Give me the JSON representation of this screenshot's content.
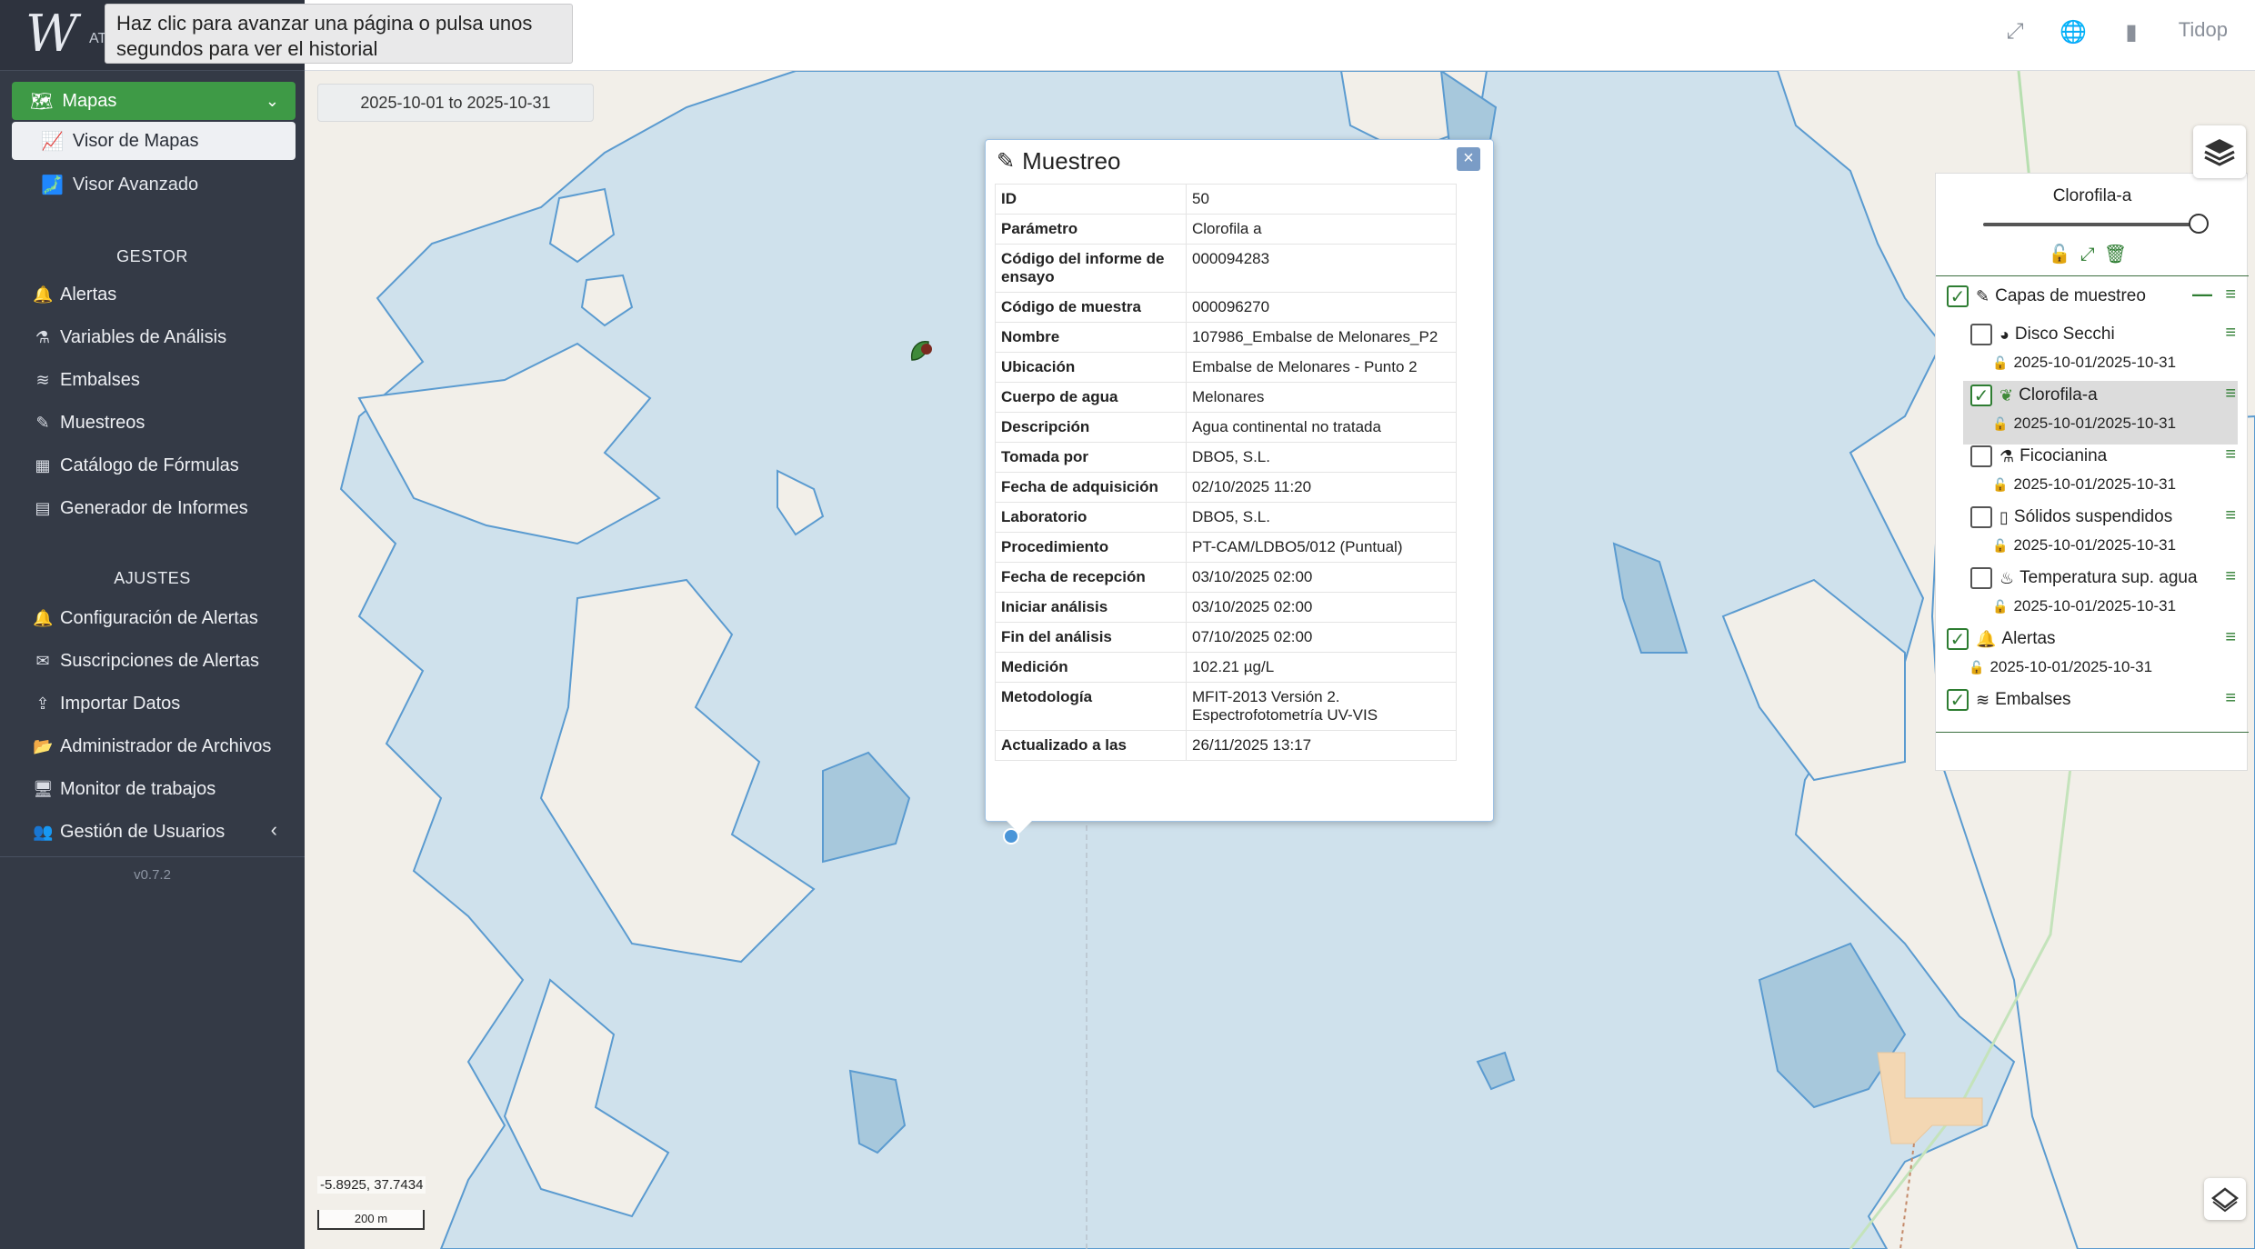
{
  "tooltip": {
    "text": "Haz clic para avanzar una página o pulsa unos segundos para ver el historial"
  },
  "logo": {
    "sub": "AT"
  },
  "sidebar": {
    "mapas": {
      "label": "Mapas"
    },
    "visor_mapas": "Visor de Mapas",
    "visor_avanzado": "Visor Avanzado",
    "gestor_head": "GESTOR",
    "gestor_items": [
      "Alertas",
      "Variables de Análisis",
      "Embalses",
      "Muestreos",
      "Catálogo de Fórmulas",
      "Generador de Informes"
    ],
    "ajustes_head": "AJUSTES",
    "ajustes_items": [
      "Configuración de Alertas",
      "Suscripciones de Alertas",
      "Importar Datos",
      "Administrador de Archivos",
      "Monitor de trabajos",
      "Gestión de Usuarios"
    ],
    "version": "v0.7.2"
  },
  "topbar": {
    "user": "Tidop"
  },
  "map": {
    "date_range": "2025-10-01 to 2025-10-31",
    "coords": "-5.8925, 37.7434",
    "scale": "200 m"
  },
  "popup": {
    "title": "Muestreo",
    "close": "×",
    "rows": [
      {
        "k": "ID",
        "v": "50"
      },
      {
        "k": "Parámetro",
        "v": "Clorofila a"
      },
      {
        "k": "Código del informe de ensayo",
        "v": "000094283"
      },
      {
        "k": "Código de muestra",
        "v": "000096270"
      },
      {
        "k": "Nombre",
        "v": "107986_Embalse de Melonares_P2"
      },
      {
        "k": "Ubicación",
        "v": "Embalse de Melonares - Punto 2"
      },
      {
        "k": "Cuerpo de agua",
        "v": "Melonares"
      },
      {
        "k": "Descripción",
        "v": "Agua continental no tratada"
      },
      {
        "k": "Tomada por",
        "v": "DBO5, S.L."
      },
      {
        "k": "Fecha de adquisición",
        "v": "02/10/2025 11:20"
      },
      {
        "k": "Laboratorio",
        "v": "DBO5, S.L."
      },
      {
        "k": "Procedimiento",
        "v": "PT-CAM/LDBO5/012 (Puntual)"
      },
      {
        "k": "Fecha de recepción",
        "v": "03/10/2025 02:00"
      },
      {
        "k": "Iniciar análisis",
        "v": "03/10/2025 02:00"
      },
      {
        "k": "Fin del análisis",
        "v": "07/10/2025 02:00"
      },
      {
        "k": "Medición",
        "v": "102.21 µg/L"
      },
      {
        "k": "Metodología",
        "v": "MFIT-2013 Versión 2. Espectrofotometría UV-VIS"
      },
      {
        "k": "Actualizado a las",
        "v": "26/11/2025 13:17"
      }
    ]
  },
  "layers": {
    "title": "Clorofila-a",
    "opacity": 1.0,
    "group": "Capas de muestreo",
    "items": [
      {
        "name": "Disco Secchi",
        "date": "2025-10-01/2025-10-31",
        "checked": false
      },
      {
        "name": "Clorofila-a",
        "date": "2025-10-01/2025-10-31",
        "checked": true
      },
      {
        "name": "Ficocianina",
        "date": "2025-10-01/2025-10-31",
        "checked": false
      },
      {
        "name": "Sólidos suspendidos",
        "date": "2025-10-01/2025-10-31",
        "checked": false
      },
      {
        "name": "Temperatura sup. agua",
        "date": "2025-10-01/2025-10-31",
        "checked": false
      }
    ],
    "alertas": {
      "name": "Alertas",
      "date": "2025-10-01/2025-10-31",
      "checked": true
    },
    "embalses": {
      "name": "Embalses",
      "checked": true
    },
    "colors": {
      "accent": "#2e7d32",
      "water": "#c5dbe8"
    }
  }
}
